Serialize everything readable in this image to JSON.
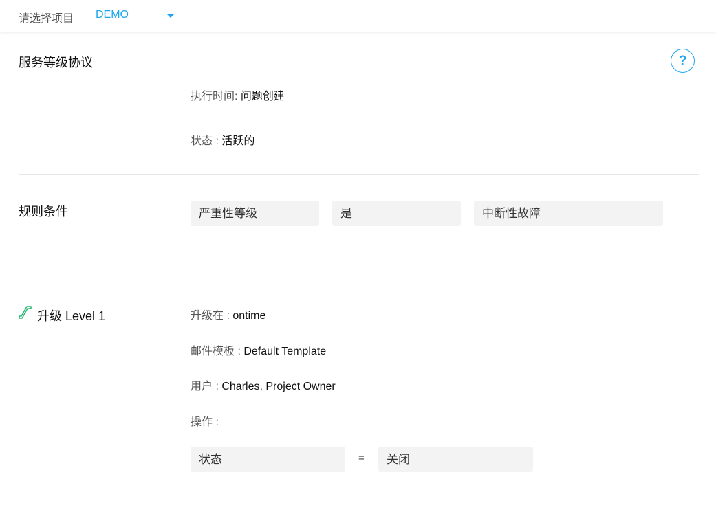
{
  "topbar": {
    "label": "请选择项目",
    "project": "DEMO"
  },
  "sla": {
    "title": "服务等级协议",
    "help": "?",
    "exec_key": "执行时间: ",
    "exec_val": "问题创建",
    "status_key": "状态 : ",
    "status_val": "活跃的"
  },
  "rules": {
    "title": "规则条件",
    "field": "严重性等级",
    "operator": "是",
    "value": "中断性故障"
  },
  "escalation": {
    "title": "升级 Level 1",
    "at_key": "升级在 : ",
    "at_val": "ontime",
    "tpl_key": "邮件模板 : ",
    "tpl_val": "Default Template",
    "user_key": "用户 : ",
    "user_val": "Charles, Project Owner",
    "action_key": "操作 :",
    "action_field": "状态",
    "action_eq": "=",
    "action_value": "关闭"
  },
  "colors": {
    "accent": "#1ea7f0",
    "icon": "#2bb673"
  }
}
